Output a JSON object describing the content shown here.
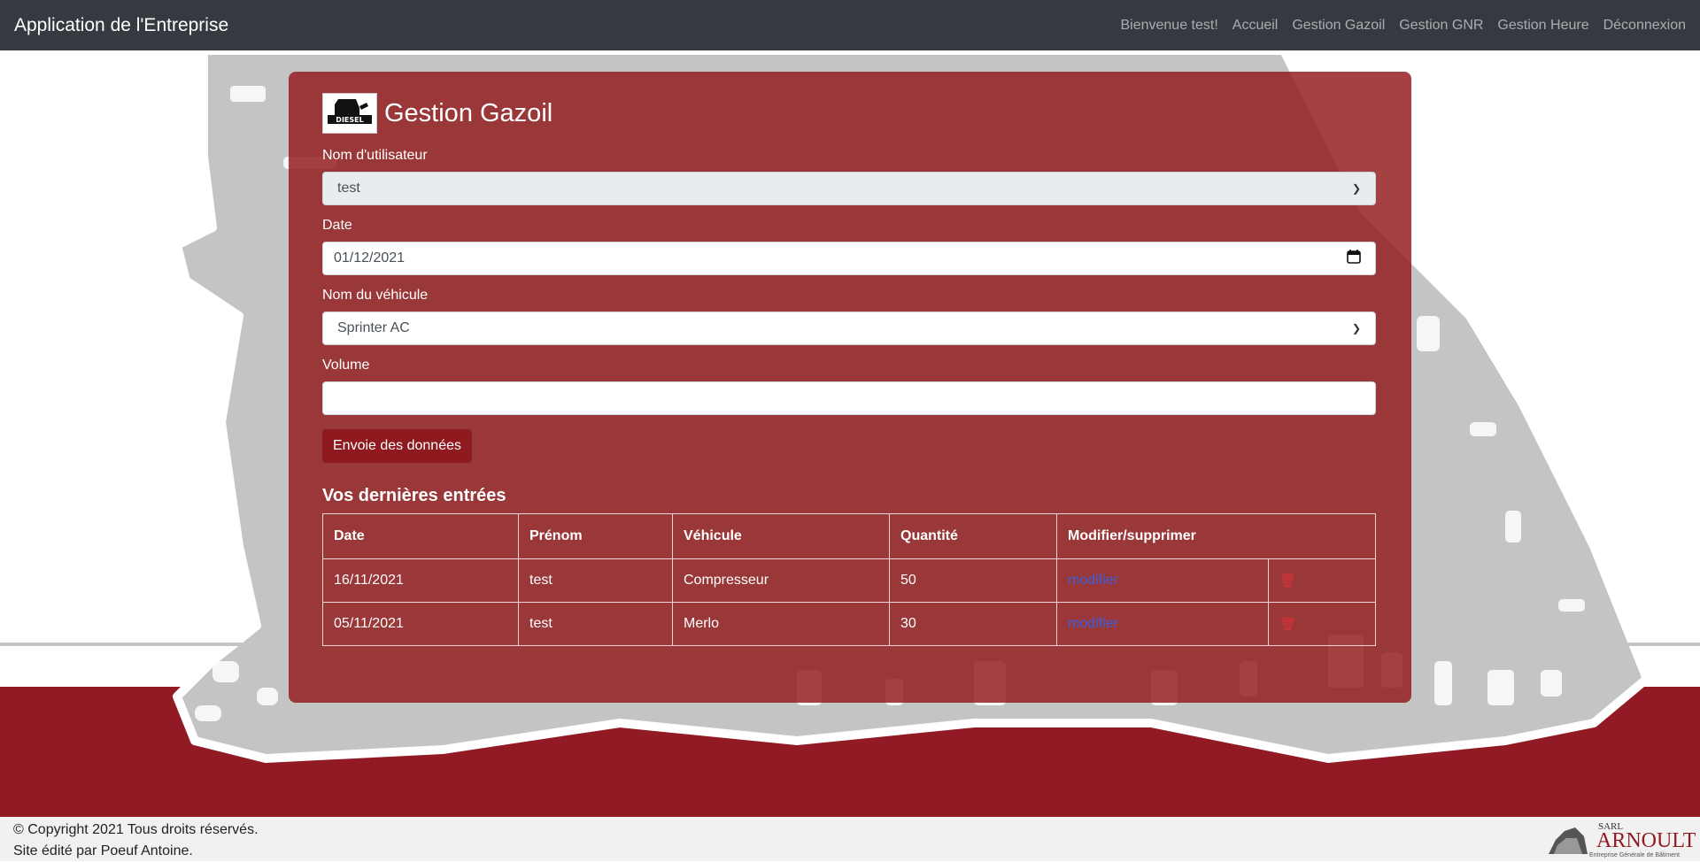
{
  "navbar": {
    "brand": "Application de l'Entreprise",
    "links": [
      "Bienvenue test!",
      "Accueil",
      "Gestion Gazoil",
      "Gestion GNR",
      "Gestion Heure",
      "Déconnexion"
    ]
  },
  "card": {
    "title": "Gestion Gazoil",
    "logo_text": "DIESEL"
  },
  "form": {
    "user_label": "Nom d'utilisateur",
    "user_value": "test",
    "date_label": "Date",
    "date_value": "01/12/2021",
    "vehicle_label": "Nom du véhicule",
    "vehicle_value": "Sprinter AC",
    "volume_label": "Volume",
    "volume_value": "",
    "submit_label": "Envoie des données"
  },
  "entries": {
    "title": "Vos dernières entrées",
    "headers": [
      "Date",
      "Prénom",
      "Véhicule",
      "Quantité",
      "Modifier/supprimer"
    ],
    "rows": [
      {
        "date": "16/11/2021",
        "prenom": "test",
        "vehicule": "Compresseur",
        "quantite": "50",
        "action": "modifier"
      },
      {
        "date": "05/11/2021",
        "prenom": "test",
        "vehicule": "Merlo",
        "quantite": "30",
        "action": "modifier"
      }
    ]
  },
  "footer": {
    "line1": "© Copyright 2021 Tous droits réservés.",
    "line2": "Site édité par Poeuf Antoine.",
    "logo_sarl": "SARL",
    "logo_name": "ARNOULT",
    "logo_sub": "Entreprise Générale de Bâtiment"
  },
  "colors": {
    "navbar": "#343a40",
    "card": "#911a1c",
    "band": "#921a24",
    "button": "#8e1a1f",
    "link": "#3b5fe0"
  }
}
